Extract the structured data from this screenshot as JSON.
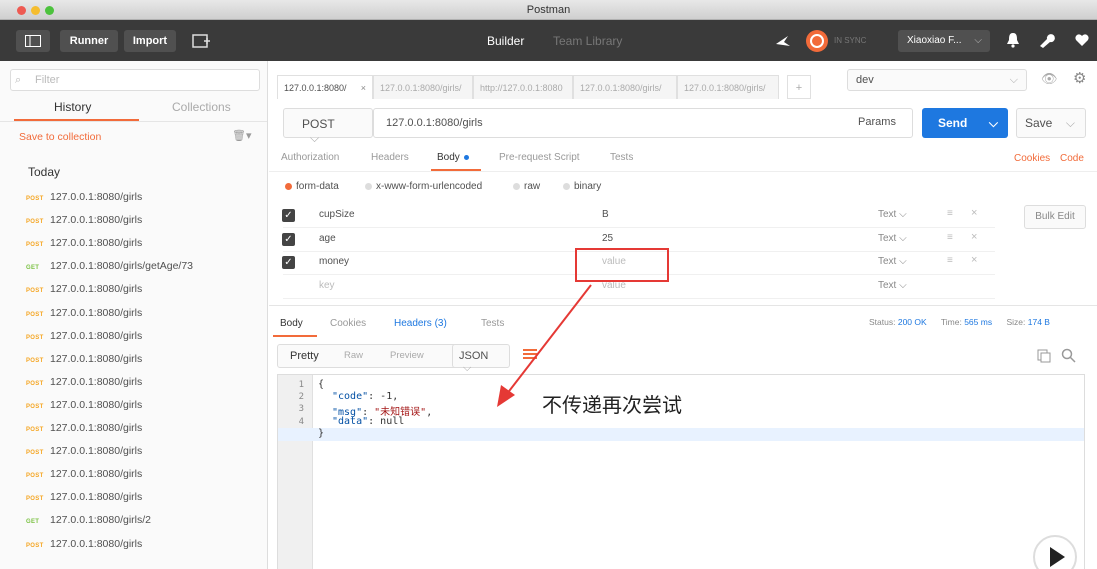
{
  "window": {
    "title": "Postman"
  },
  "toolbar": {
    "runner": "Runner",
    "import": "Import",
    "builder": "Builder",
    "team_library": "Team Library",
    "sync": "IN SYNC",
    "user": "Xiaoxiao F..."
  },
  "sidebar": {
    "filter_placeholder": "Filter",
    "tabs": [
      "History",
      "Collections"
    ],
    "save_to_collection": "Save to collection",
    "group": "Today",
    "items": [
      {
        "method": "POST",
        "url": "127.0.0.1:8080/girls"
      },
      {
        "method": "POST",
        "url": "127.0.0.1:8080/girls"
      },
      {
        "method": "POST",
        "url": "127.0.0.1:8080/girls"
      },
      {
        "method": "GET",
        "url": "127.0.0.1:8080/girls/getAge/73"
      },
      {
        "method": "POST",
        "url": "127.0.0.1:8080/girls"
      },
      {
        "method": "POST",
        "url": "127.0.0.1:8080/girls"
      },
      {
        "method": "POST",
        "url": "127.0.0.1:8080/girls"
      },
      {
        "method": "POST",
        "url": "127.0.0.1:8080/girls"
      },
      {
        "method": "POST",
        "url": "127.0.0.1:8080/girls"
      },
      {
        "method": "POST",
        "url": "127.0.0.1:8080/girls"
      },
      {
        "method": "POST",
        "url": "127.0.0.1:8080/girls"
      },
      {
        "method": "POST",
        "url": "127.0.0.1:8080/girls"
      },
      {
        "method": "POST",
        "url": "127.0.0.1:8080/girls"
      },
      {
        "method": "POST",
        "url": "127.0.0.1:8080/girls"
      },
      {
        "method": "GET",
        "url": "127.0.0.1:8080/girls/2"
      },
      {
        "method": "POST",
        "url": "127.0.0.1:8080/girls"
      }
    ]
  },
  "request_tabs": [
    {
      "label": "127.0.0.1:8080/",
      "active": true
    },
    {
      "label": "127.0.0.1:8080/girls/",
      "active": false
    },
    {
      "label": "http://127.0.0.1:8080",
      "active": false
    },
    {
      "label": "127.0.0.1:8080/girls/",
      "active": false
    },
    {
      "label": "127.0.0.1:8080/girls/",
      "active": false
    }
  ],
  "environment": "dev",
  "request": {
    "method": "POST",
    "url": "127.0.0.1:8080/girls",
    "params": "Params",
    "send": "Send",
    "save": "Save"
  },
  "request_subtabs": [
    "Authorization",
    "Headers",
    "Body",
    "Pre-request Script",
    "Tests"
  ],
  "links": {
    "cookies": "Cookies",
    "code": "Code"
  },
  "body_types": [
    "form-data",
    "x-www-form-urlencoded",
    "raw",
    "binary"
  ],
  "form": {
    "rows": [
      {
        "key": "cupSize",
        "value": "B",
        "type": "Text"
      },
      {
        "key": "age",
        "value": "25",
        "type": "Text"
      },
      {
        "key": "money",
        "value": "value",
        "type": "Text"
      }
    ],
    "new_row": {
      "key": "key",
      "value": "value",
      "type": "Text"
    },
    "bulk_edit": "Bulk Edit"
  },
  "response": {
    "tabs": [
      "Body",
      "Cookies",
      "Headers (3)",
      "Tests"
    ],
    "status_label": "Status:",
    "status": "200 OK",
    "time_label": "Time:",
    "time": "565 ms",
    "size_label": "Size:",
    "size": "174 B",
    "views": [
      "Pretty",
      "Raw",
      "Preview"
    ],
    "format": "JSON",
    "lines": [
      {
        "n": "1",
        "t": "{"
      },
      {
        "n": "2",
        "k": "\"code\"",
        "v": " -1,"
      },
      {
        "n": "3",
        "k": "\"msg\"",
        "s": "\"未知错误\"",
        "v": ","
      },
      {
        "n": "4",
        "k": "\"data\"",
        "v": " null"
      },
      {
        "n": "5",
        "t": "}"
      }
    ]
  },
  "annotation": {
    "text": "不传递再次尝试",
    "color": "#e53935"
  },
  "colors": {
    "accent": "#f26b3a",
    "send": "#1e78e0",
    "post": "#f5a623",
    "get": "#7ac142"
  }
}
